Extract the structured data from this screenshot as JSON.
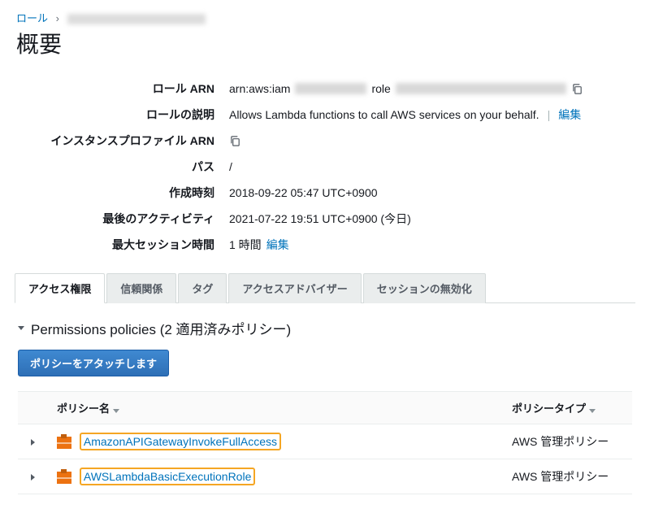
{
  "breadcrumb": {
    "root_label": "ロール",
    "separator": "›"
  },
  "page_title": "概要",
  "summary": {
    "role_arn": {
      "label": "ロール ARN",
      "prefix": "arn:aws:iam",
      "middle": "role"
    },
    "role_desc": {
      "label": "ロールの説明",
      "value": "Allows Lambda functions to call AWS services on your behalf.",
      "edit": "編集"
    },
    "instance_profile": {
      "label": "インスタンスプロファイル ARN"
    },
    "path": {
      "label": "パス",
      "value": "/"
    },
    "created": {
      "label": "作成時刻",
      "value": "2018-09-22 05:47 UTC+0900"
    },
    "last_activity": {
      "label": "最後のアクティビティ",
      "value": "2021-07-22 19:51 UTC+0900 (今日)"
    },
    "max_session": {
      "label": "最大セッション時間",
      "value": "1 時間",
      "edit": "編集"
    }
  },
  "tabs": {
    "permissions": "アクセス権限",
    "trust": "信頼関係",
    "tags": "タグ",
    "access_advisor": "アクセスアドバイザー",
    "revoke": "セッションの無効化"
  },
  "policies_section": {
    "title": "Permissions policies (2 適用済みポリシー)",
    "attach_btn": "ポリシーをアタッチします",
    "col_name": "ポリシー名",
    "col_type": "ポリシータイプ",
    "rows": [
      {
        "name": "AmazonAPIGatewayInvokeFullAccess",
        "type": "AWS 管理ポリシー"
      },
      {
        "name": "AWSLambdaBasicExecutionRole",
        "type": "AWS 管理ポリシー"
      }
    ]
  }
}
